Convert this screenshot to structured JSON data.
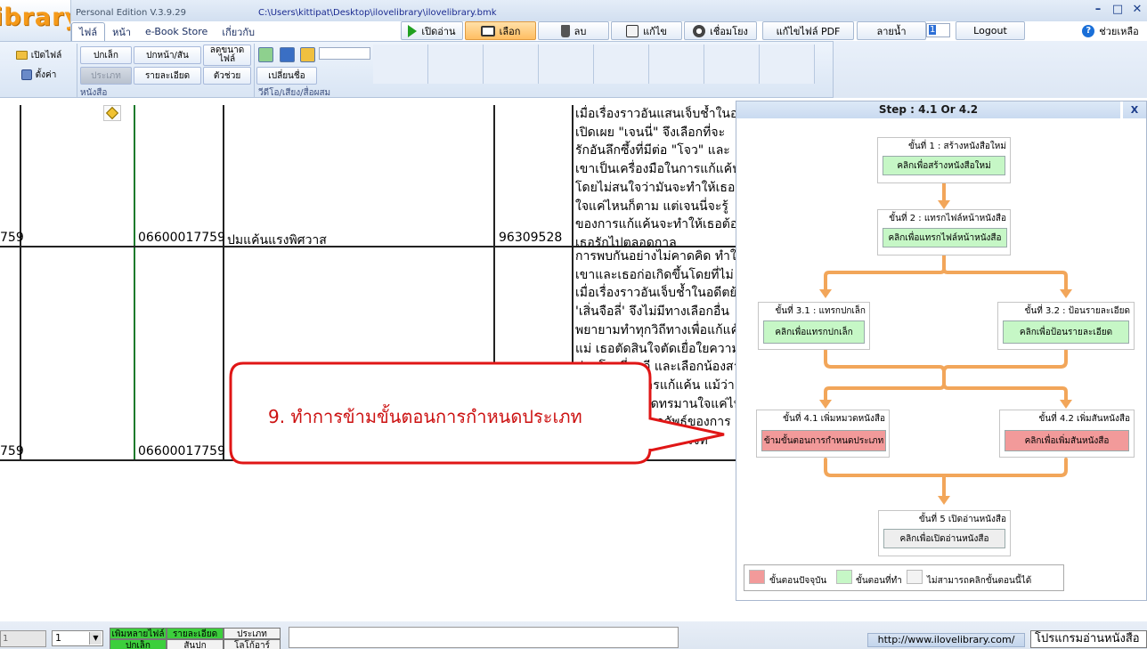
{
  "app": {
    "logo_text": "ibrary",
    "version": "Personal Edition V.3.9.29",
    "file_path": "C:\\Users\\kittipat\\Desktop\\ilovelibrary\\ilovelibrary.bmk",
    "window_controls": [
      "minimize-icon",
      "restore-icon",
      "close-icon"
    ]
  },
  "toolbar": {
    "read": "เปิดอ่าน",
    "select": "เลือก",
    "delete": "ลบ",
    "edit": "แก้ไข",
    "link": "เชื่อมโยง",
    "edit_pdf": "แก้ไขไฟล์ PDF",
    "watermark": "ลายน้ำ",
    "page_number": "1",
    "logout": "Logout",
    "help": "ช่วยเหลือ"
  },
  "menu_tabs": [
    "ไฟล์",
    "หน้า",
    "e-Book Store",
    "เกี่ยวกับ"
  ],
  "ribbon": {
    "open_file": "เปิดไฟล์",
    "settings": "ตั้งค่า",
    "small_cover": "ปกเล็ก",
    "front_back_cover": "ปกหน้า/สัน",
    "shrink_file": "ลดขนาดไฟล์",
    "category": "ประเภท",
    "details": "รายละเอียด",
    "helper": "ตัวช่วย",
    "group_book": "หนังสือ",
    "rename": "เปลี่ยนชื่อ",
    "group_media": "วีดีโอ/เสียง/สื่อผสม"
  },
  "grid": {
    "rows": [
      {
        "id_partial": "759",
        "code": "06600017759",
        "title": "ปมแค้นแรงพิศวาส",
        "number": "96309528",
        "description_lines": [
          "เมื่อเรื่องราวอันแสนเจ็บช้ำในอดีต",
          "เปิดเผย \"เจนนี่\" จึงเลือกที่จะ",
          "รักอันลึกซึ้งที่มีต่อ \"โจว\" และ",
          "เขาเป็นเครื่องมือในการแก้แค้น",
          "โดยไม่สนใจว่ามันจะทำให้เธอ",
          "ใจแค่ไหนก็ตาม แต่เจนนี่จะรู้",
          "ของการแก้แค้นจะทำให้เธอต้อง",
          "เธอรักไปตลอดกาล"
        ]
      },
      {
        "id_partial": "759",
        "code": "06600017759",
        "title": "",
        "number": "",
        "description_lines": [
          "การพบกันอย่างไม่คาดคิด ทำให้",
          "เขาและเธอก่อเกิดขึ้นโดยที่ไม่",
          "เมื่อเรื่องราวอันเจ็บช้ำในอดีตย้อน",
          "'เสิ่นจือลี่' จึงไม่มีทางเลือกอื่น",
          "พยายามทำทุกวิถีทางเพื่อแก้แค้น",
          "แม่ เธอตัดสินใจตัดเยื่อใยความ",
          "ท่านโจวลี่ซูจวี และเลือกน้องสาว",
          "เครื่องมือในการแก้แค้น แม้ว่า",
          "เธอต้องเจ็บปวดทรมานใจแค่ไหน",
          "เธอไม่รู้เลยว่าผลลัพธ์ของการ",
          "กลับกลายเป็นแผลในใจที่"
        ]
      }
    ]
  },
  "callout": {
    "text": "9. ทำการข้ามขั้นตอนการกำหนดประเภท"
  },
  "step_panel": {
    "title": "Step : 4.1 Or 4.2",
    "close": "X",
    "steps": [
      {
        "title": "ขั้นที่ 1 : สร้างหนังสือใหม่",
        "button": "คลิกเพื่อสร้างหนังสือใหม่",
        "state": "done"
      },
      {
        "title": "ขั้นที่ 2 : แทรกไฟล์หน้าหนังสือ",
        "button": "คลิกเพื่อแทรกไฟล์หน้าหนังสือ",
        "state": "done"
      },
      {
        "title": "ขั้นที่ 3.1 : แทรกปกเล็ก",
        "button": "คลิกเพื่อแทรกปกเล็ก",
        "state": "done"
      },
      {
        "title": "ขั้นที่ 3.2 : ป้อนรายละเอียด",
        "button": "คลิกเพื่อป้อนรายละเอียด",
        "state": "done"
      },
      {
        "title": "ขั้นที่ 4.1 เพิ่มหมวดหนังสือ",
        "button": "ข้ามขั้นตอนการกำหนดประเภท",
        "state": "current"
      },
      {
        "title": "ขั้นที่ 4.2 เพิ่มสันหนังสือ",
        "button": "คลิกเพื่อเพิ่มสันหนังสือ",
        "state": "current"
      },
      {
        "title": "ขั้นที่ 5 เปิดอ่านหนังสือ",
        "button": "คลิกเพื่อเปิดอ่านหนังสือ",
        "state": "unavailable"
      }
    ],
    "legend": {
      "current": "ขั้นตอนปัจจุบัน",
      "done": "ขั้นตอนที่ทำ",
      "unavailable": "ไม่สามารถคลิกขั้นตอนนี้ได้"
    },
    "colors": {
      "current": "#f29a9a",
      "done": "#c6f7c6",
      "unavailable": "#eeeeee",
      "arrow": "#f2a65a"
    }
  },
  "bottom": {
    "input_value": "1",
    "select_value": "1",
    "cells": [
      "เพิ่มหลายไฟล์",
      "รายละเอียด",
      "ประเภท",
      "ปกเล็ก",
      "สันปก",
      "โลโก้อาร์"
    ],
    "url": "http://www.ilovelibrary.com/",
    "reader_label": "โปรแกรมอ่านหนังสือ"
  }
}
